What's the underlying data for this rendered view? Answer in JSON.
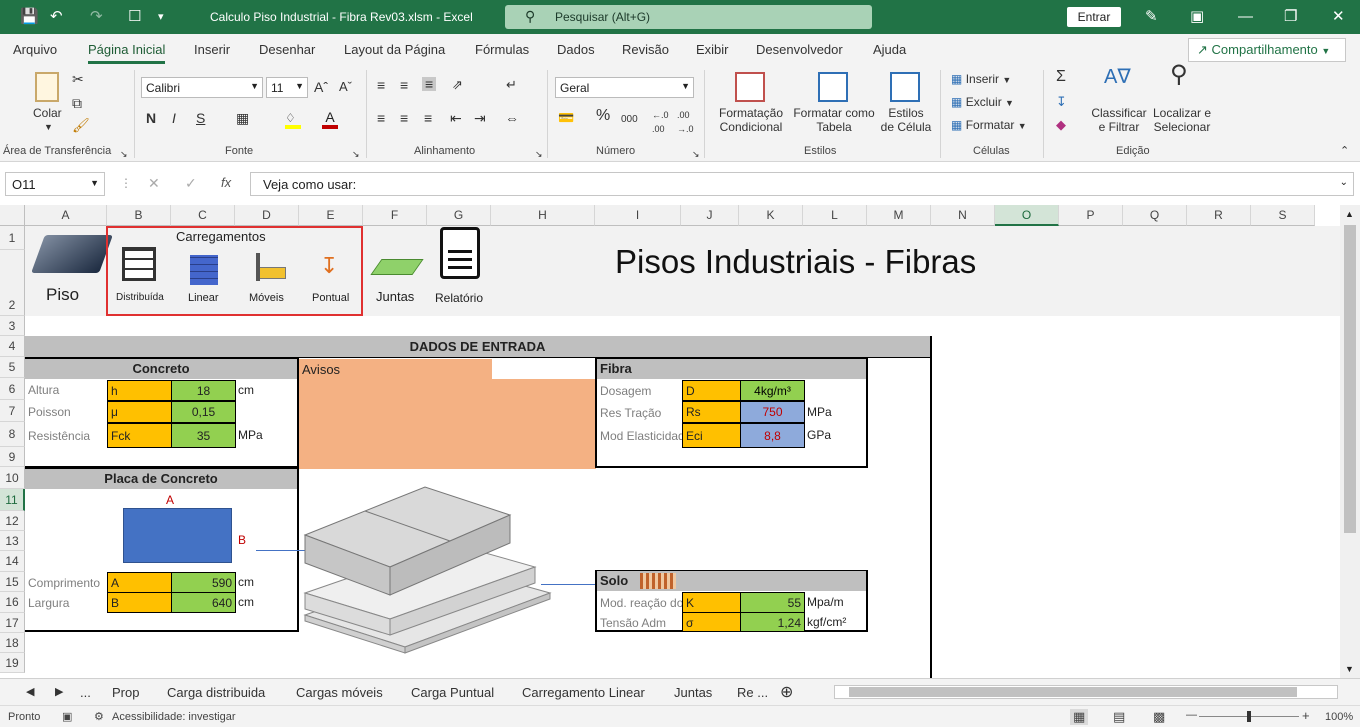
{
  "titlebar": {
    "title": "Calculo Piso Industrial - Fibra Rev03.xlsm  -  Excel",
    "search_placeholder": "Pesquisar (Alt+G)",
    "signin": "Entrar"
  },
  "menu": {
    "tabs": [
      "Arquivo",
      "Página Inicial",
      "Inserir",
      "Desenhar",
      "Layout da Página",
      "Fórmulas",
      "Dados",
      "Revisão",
      "Exibir",
      "Desenvolvedor",
      "Ajuda"
    ],
    "share": "Compartilhamento"
  },
  "ribbon": {
    "clipboard": {
      "paste": "Colar",
      "group": "Área de Transferência"
    },
    "font": {
      "name": "Calibri",
      "size": "11",
      "bold": "N",
      "italic": "I",
      "underline": "S",
      "group": "Fonte"
    },
    "alignment": {
      "group": "Alinhamento"
    },
    "number": {
      "format": "Geral",
      "percent": "%",
      "thousands": "000",
      "group": "Número"
    },
    "styles": {
      "conditional": "Formatação Condicional",
      "as_table": "Formatar como Tabela",
      "cell_styles": "Estilos de Célula",
      "group": "Estilos"
    },
    "cells": {
      "insert": "Inserir",
      "delete": "Excluir",
      "format": "Formatar",
      "group": "Células"
    },
    "editing": {
      "sort": "Classificar e Filtrar",
      "find": "Localizar e Selecionar",
      "group": "Edição"
    }
  },
  "formula_bar": {
    "name_box": "O11",
    "formula": "Veja como usar:"
  },
  "columns": [
    "A",
    "B",
    "C",
    "D",
    "E",
    "F",
    "G",
    "H",
    "I",
    "J",
    "K",
    "L",
    "M",
    "N",
    "O",
    "P",
    "Q",
    "R",
    "S"
  ],
  "rows": [
    "1",
    "2",
    "3",
    "4",
    "5",
    "6",
    "7",
    "8",
    "9",
    "10",
    "11",
    "12",
    "13",
    "14",
    "15",
    "16",
    "17",
    "18",
    "19"
  ],
  "sheet": {
    "piso": "Piso",
    "carregamentos": "Carregamentos",
    "load_buttons": [
      "Distribuída",
      "Linear",
      "Móveis",
      "Pontual"
    ],
    "juntas": "Juntas",
    "relatorio": "Relatório",
    "main_title": "Pisos Industriais - Fibras",
    "dados_entrada": "DADOS DE ENTRADA",
    "concreto": {
      "title": "Concreto",
      "rows": [
        {
          "label": "Altura",
          "sym": "h",
          "value": "18",
          "unit": "cm"
        },
        {
          "label": "Poisson",
          "sym": "μ",
          "value": "0,15",
          "unit": ""
        },
        {
          "label": "Resistência",
          "sym": "Fck",
          "value": "35",
          "unit": "MPa"
        }
      ]
    },
    "avisos": "Avisos",
    "fibra": {
      "title": "Fibra",
      "rows": [
        {
          "label": "Dosagem",
          "sym": "D",
          "value": "4kg/m³",
          "unit": ""
        },
        {
          "label": "Res Tração",
          "sym": "Rs",
          "value": "750",
          "unit": "MPa"
        },
        {
          "label": "Mod Elasticidade",
          "sym": "Eci",
          "value": "8,8",
          "unit": "GPa"
        }
      ]
    },
    "placa": {
      "title": "Placa de Concreto",
      "dim_a": "A",
      "dim_b": "B",
      "rows": [
        {
          "label": "Comprimento",
          "sym": "A",
          "value": "590",
          "unit": "cm"
        },
        {
          "label": "Largura",
          "sym": "B",
          "value": "640",
          "unit": "cm"
        }
      ]
    },
    "solo": {
      "title": "Solo",
      "rows": [
        {
          "label": "Mod. reação do",
          "sym": "K",
          "value": "55",
          "unit": "Mpa/m"
        },
        {
          "label": "Tensão Adm",
          "sym": "σ",
          "value": "1,24",
          "unit": "kgf/cm²"
        }
      ]
    }
  },
  "sheet_tabs": [
    "...",
    "Prop",
    "Carga distribuida",
    "Cargas móveis",
    "Carga Puntual",
    "Carregamento Linear",
    "Juntas",
    "Re ..."
  ],
  "status": {
    "ready": "Pronto",
    "accessibility": "Acessibilidade: investigar",
    "zoom": "100%"
  },
  "colors": {
    "excel_green": "#217346",
    "orange": "#ffc000",
    "green": "#92d050",
    "blue_cell": "#4472c4",
    "salmon": "#f4b183"
  }
}
